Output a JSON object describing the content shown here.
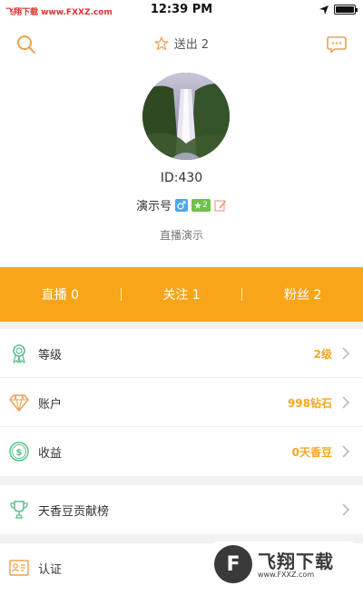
{
  "status_bar": {
    "watermark": "飞翔下载 www.FXXZ.com",
    "time": "12:39 PM"
  },
  "header": {
    "sent_label": "送出 2"
  },
  "profile": {
    "user_id": "ID:430",
    "name": "演示号",
    "level_badge": "2",
    "signature": "直播演示"
  },
  "stats": [
    {
      "label": "直播 0"
    },
    {
      "label": "关注 1"
    },
    {
      "label": "粉丝 2"
    }
  ],
  "menu_group1": [
    {
      "label": "等级",
      "value": "2级"
    },
    {
      "label": "账户",
      "value": "998钻石"
    },
    {
      "label": "收益",
      "value": "0天香豆"
    }
  ],
  "menu_group2": [
    {
      "label": "天香豆贡献榜",
      "value": ""
    }
  ],
  "menu_group3": [
    {
      "label": "认证",
      "value": ""
    }
  ],
  "logo_mark": {
    "circle_letter": "F",
    "text": "飞翔下载",
    "url": "www.FXXZ.com"
  },
  "colors": {
    "accent": "#f9a51a",
    "value_text": "#f6a623",
    "icon_orange": "#f0a050",
    "icon_green": "#5bbf8a"
  }
}
